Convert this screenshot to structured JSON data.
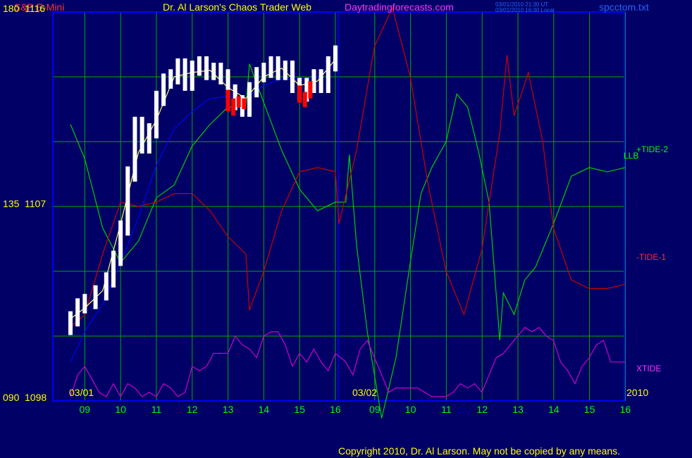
{
  "header": {
    "symbol": "S&P E-Mini",
    "title": "Dr. Al Larson's Chaos Trader Web",
    "site": "Daytradingforecasts.com",
    "timestamp_ut": "03/01/2010 21:30 UT",
    "timestamp_local": "03/01/2010 16:30 Local",
    "filename": "spcctom.txt"
  },
  "y_axis": {
    "top": {
      "osc": "180",
      "price": "1116"
    },
    "mid": {
      "osc": "135",
      "price": "1107"
    },
    "bottom": {
      "osc": "090",
      "price": "1098"
    }
  },
  "x_axis": {
    "hours": [
      "09",
      "10",
      "11",
      "12",
      "13",
      "14",
      "15",
      "16",
      "09",
      "10",
      "11",
      "12",
      "13",
      "14",
      "15",
      "16"
    ],
    "date_labels": [
      "03/01",
      "03/02"
    ],
    "year": "2010"
  },
  "legend": {
    "llb": "LLB",
    "tide2": "+TIDE-2",
    "tide1": "-TIDE-1",
    "xtide": "XTIDE"
  },
  "footer": {
    "copyright": "Copyright 2010, Dr. Al Larson. May not be copied by any means."
  },
  "colors": {
    "background": "#000066",
    "grid": "#00aa00",
    "frame": "#0000ff",
    "price_up": "#ffffff",
    "price_down": "#ff0000",
    "tide2": "#00cc00",
    "tide1": "#cc0000",
    "xtide": "#cc00cc",
    "llb": "#0000ff",
    "price_ma": "#ffff66",
    "header_red": "#ff3333",
    "header_yellow": "#ffff00",
    "header_magenta": "#ff33ff",
    "header_blue": "#2266ff",
    "axis_yellow": "#ffff00",
    "axis_green": "#00ff00"
  },
  "chart_data": {
    "type": "line",
    "x_unit": "hour",
    "price_range": [
      1098,
      1116
    ],
    "osc_range": [
      90,
      180
    ],
    "price_close": [
      [
        8.6,
        1101.8
      ],
      [
        8.8,
        1102.4
      ],
      [
        9.0,
        1102.6
      ],
      [
        9.3,
        1103.0
      ],
      [
        9.6,
        1103.6
      ],
      [
        9.8,
        1104.6
      ],
      [
        10.0,
        1106.0
      ],
      [
        10.2,
        1108.5
      ],
      [
        10.4,
        1110.8
      ],
      [
        10.6,
        1109.8
      ],
      [
        10.8,
        1110.5
      ],
      [
        11.0,
        1112.0
      ],
      [
        11.2,
        1112.8
      ],
      [
        11.4,
        1113.0
      ],
      [
        11.6,
        1113.5
      ],
      [
        11.8,
        1112.7
      ],
      [
        12.0,
        1113.4
      ],
      [
        12.2,
        1113.6
      ],
      [
        12.4,
        1113.2
      ],
      [
        12.6,
        1113.3
      ],
      [
        12.8,
        1113.0
      ],
      [
        13.0,
        1112.3
      ],
      [
        13.2,
        1111.8
      ],
      [
        13.4,
        1111.5
      ],
      [
        13.6,
        1112.4
      ],
      [
        13.8,
        1113.1
      ],
      [
        14.0,
        1113.3
      ],
      [
        14.2,
        1113.6
      ],
      [
        14.4,
        1113.2
      ],
      [
        14.6,
        1113.4
      ],
      [
        14.8,
        1112.6
      ],
      [
        15.0,
        1112.2
      ],
      [
        15.2,
        1112.6
      ],
      [
        15.4,
        1113.0
      ],
      [
        15.6,
        1112.6
      ],
      [
        15.8,
        1113.6
      ],
      [
        16.0,
        1114.1
      ]
    ],
    "price_down_bars": [
      [
        13.0,
        1112.4,
        1111.4
      ],
      [
        13.15,
        1112.0,
        1111.2
      ],
      [
        13.3,
        1112.1,
        1111.6
      ],
      [
        13.45,
        1112.0,
        1111.5
      ],
      [
        15.0,
        1112.6,
        1111.8
      ],
      [
        15.15,
        1112.3,
        1111.6
      ],
      [
        15.3,
        1112.8,
        1112.0
      ]
    ],
    "series": [
      {
        "name": "+TIDE-2",
        "points": [
          [
            8.6,
            154
          ],
          [
            9.0,
            146
          ],
          [
            9.5,
            130
          ],
          [
            10.0,
            122
          ],
          [
            10.5,
            127
          ],
          [
            11.0,
            137
          ],
          [
            11.5,
            140
          ],
          [
            12.0,
            149
          ],
          [
            12.5,
            154
          ],
          [
            13.0,
            158
          ],
          [
            13.5,
            158
          ],
          [
            13.6,
            168
          ],
          [
            14.0,
            159
          ],
          [
            14.5,
            148
          ],
          [
            15.0,
            139
          ],
          [
            15.5,
            134
          ],
          [
            16.0,
            136
          ],
          [
            16.2,
            136
          ],
          [
            16.3,
            147
          ],
          [
            16.5,
            126
          ],
          [
            16.8,
            106
          ],
          [
            17.2,
            86
          ],
          [
            17.6,
            100
          ],
          [
            18.0,
            122
          ],
          [
            18.3,
            138
          ],
          [
            18.6,
            144
          ],
          [
            19.0,
            150
          ],
          [
            19.3,
            161
          ],
          [
            19.6,
            158
          ],
          [
            19.9,
            148
          ],
          [
            20.2,
            136
          ],
          [
            20.5,
            104
          ],
          [
            20.6,
            115
          ],
          [
            20.9,
            110
          ],
          [
            21.2,
            118
          ],
          [
            21.5,
            121
          ],
          [
            22.0,
            131
          ],
          [
            22.5,
            142
          ],
          [
            23.0,
            144
          ],
          [
            23.5,
            143
          ],
          [
            24.0,
            144
          ]
        ]
      },
      {
        "name": "-TIDE-1",
        "points": [
          [
            8.6,
            107
          ],
          [
            9.0,
            110
          ],
          [
            9.5,
            124
          ],
          [
            10.0,
            136
          ],
          [
            10.5,
            135
          ],
          [
            11.0,
            136
          ],
          [
            11.5,
            138
          ],
          [
            12.0,
            138
          ],
          [
            12.5,
            134
          ],
          [
            13.0,
            128
          ],
          [
            13.5,
            124
          ],
          [
            13.6,
            111
          ],
          [
            14.0,
            120
          ],
          [
            14.5,
            134
          ],
          [
            15.0,
            143
          ],
          [
            15.5,
            144
          ],
          [
            16.0,
            143
          ],
          [
            16.1,
            131
          ],
          [
            16.5,
            148
          ],
          [
            17.0,
            172
          ],
          [
            17.5,
            181
          ],
          [
            18.0,
            165
          ],
          [
            18.5,
            140
          ],
          [
            19.0,
            120
          ],
          [
            19.5,
            110
          ],
          [
            20.0,
            125
          ],
          [
            20.5,
            152
          ],
          [
            20.7,
            170
          ],
          [
            20.9,
            156
          ],
          [
            21.3,
            166
          ],
          [
            21.7,
            150
          ],
          [
            22.0,
            130
          ],
          [
            22.5,
            118
          ],
          [
            23.0,
            116
          ],
          [
            23.5,
            116
          ],
          [
            24.0,
            117
          ]
        ]
      },
      {
        "name": "XTIDE",
        "points": [
          [
            8.6,
            91
          ],
          [
            8.8,
            96
          ],
          [
            9.0,
            98
          ],
          [
            9.2,
            95
          ],
          [
            9.4,
            92
          ],
          [
            9.6,
            91
          ],
          [
            9.8,
            94
          ],
          [
            10.0,
            91
          ],
          [
            10.2,
            94
          ],
          [
            10.4,
            93
          ],
          [
            10.6,
            91
          ],
          [
            10.8,
            92
          ],
          [
            11.0,
            91
          ],
          [
            11.2,
            94
          ],
          [
            11.4,
            93
          ],
          [
            11.6,
            91
          ],
          [
            11.8,
            92
          ],
          [
            12.0,
            98
          ],
          [
            12.2,
            97
          ],
          [
            12.4,
            98
          ],
          [
            12.6,
            101
          ],
          [
            12.8,
            101
          ],
          [
            13.0,
            101
          ],
          [
            13.2,
            105
          ],
          [
            13.4,
            103
          ],
          [
            13.6,
            102
          ],
          [
            13.8,
            100
          ],
          [
            14.0,
            105
          ],
          [
            14.2,
            106
          ],
          [
            14.4,
            106
          ],
          [
            14.6,
            103
          ],
          [
            14.8,
            98
          ],
          [
            15.0,
            101
          ],
          [
            15.2,
            99
          ],
          [
            15.4,
            102
          ],
          [
            15.6,
            99
          ],
          [
            15.8,
            97
          ],
          [
            16.0,
            101
          ],
          [
            16.2,
            99
          ],
          [
            16.4,
            96
          ],
          [
            16.6,
            102
          ],
          [
            16.8,
            104
          ],
          [
            17.0,
            100
          ],
          [
            17.2,
            96
          ],
          [
            17.4,
            92
          ],
          [
            17.6,
            93
          ],
          [
            17.8,
            93
          ],
          [
            18.0,
            93
          ],
          [
            18.2,
            93
          ],
          [
            18.4,
            92
          ],
          [
            18.6,
            91
          ],
          [
            18.8,
            91
          ],
          [
            19.0,
            91
          ],
          [
            19.2,
            92
          ],
          [
            19.4,
            94
          ],
          [
            19.6,
            93
          ],
          [
            19.8,
            94
          ],
          [
            20.0,
            92
          ],
          [
            20.2,
            96
          ],
          [
            20.4,
            100
          ],
          [
            20.6,
            101
          ],
          [
            20.8,
            103
          ],
          [
            21.0,
            105
          ],
          [
            21.2,
            107
          ],
          [
            21.4,
            106
          ],
          [
            21.6,
            107
          ],
          [
            21.8,
            105
          ],
          [
            22.0,
            104
          ],
          [
            22.2,
            99
          ],
          [
            22.4,
            97
          ],
          [
            22.6,
            94
          ],
          [
            22.8,
            98
          ],
          [
            23.0,
            100
          ],
          [
            23.2,
            103
          ],
          [
            23.4,
            104
          ],
          [
            23.6,
            99
          ],
          [
            23.8,
            99
          ],
          [
            24.0,
            99
          ]
        ]
      },
      {
        "name": "LLB",
        "points": [
          [
            8.6,
            1099.8
          ],
          [
            9.0,
            1101.2
          ],
          [
            9.5,
            1102.5
          ],
          [
            10.0,
            1104.4
          ],
          [
            10.5,
            1106.5
          ],
          [
            11.0,
            1108.9
          ],
          [
            11.5,
            1110.6
          ],
          [
            12.0,
            1111.4
          ],
          [
            12.5,
            1112.0
          ],
          [
            13.0,
            1112.1
          ],
          [
            13.5,
            1112.0
          ],
          [
            14.0,
            1112.6
          ],
          [
            14.5,
            1112.9
          ],
          [
            15.0,
            1112.9
          ],
          [
            15.5,
            1113.0
          ],
          [
            16.0,
            1113.6
          ]
        ]
      },
      {
        "name": "price-ma",
        "points": [
          [
            8.6,
            1101.8
          ],
          [
            9.0,
            1102.3
          ],
          [
            9.5,
            1103.1
          ],
          [
            10.0,
            1106.2
          ],
          [
            10.5,
            1109.5
          ],
          [
            11.0,
            1111.0
          ],
          [
            11.5,
            1113.0
          ],
          [
            12.0,
            1113.2
          ],
          [
            12.5,
            1113.3
          ],
          [
            13.0,
            1112.5
          ],
          [
            13.5,
            1112.0
          ],
          [
            14.0,
            1113.0
          ],
          [
            14.5,
            1113.4
          ],
          [
            15.0,
            1112.6
          ],
          [
            15.5,
            1112.8
          ],
          [
            16.0,
            1113.8
          ]
        ]
      }
    ]
  }
}
